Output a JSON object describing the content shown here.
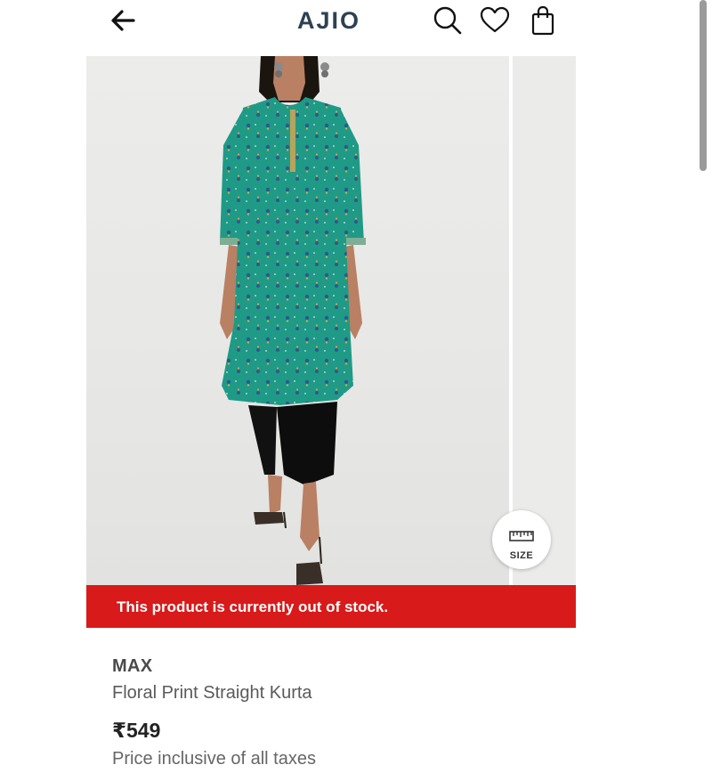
{
  "header": {
    "logo": "AJIO",
    "back_icon": "arrow-left-icon",
    "search_icon": "search-icon",
    "wishlist_icon": "heart-icon",
    "bag_icon": "shopping-bag-icon"
  },
  "gallery": {
    "size_label": "SIZE",
    "size_icon": "ruler-icon"
  },
  "stock_banner": {
    "text": "This product is currently out of stock.",
    "color": "#d81a1a"
  },
  "product": {
    "brand": "MAX",
    "name": "Floral Print Straight Kurta",
    "price": "₹549",
    "tax_note": "Price inclusive of all taxes"
  },
  "colors": {
    "logo": "#2c4152",
    "kurta": "#1f9a86",
    "banner": "#d81a1a"
  }
}
